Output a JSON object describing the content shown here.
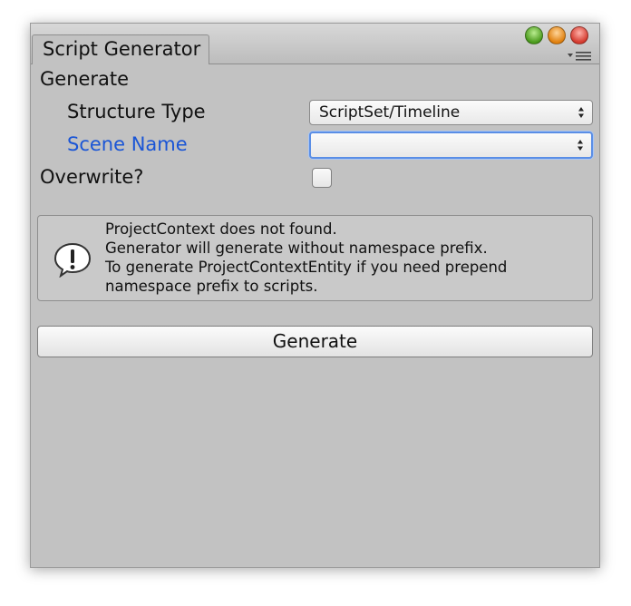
{
  "window": {
    "tab_title": "Script Generator"
  },
  "section": {
    "title": "Generate"
  },
  "fields": {
    "structure_type": {
      "label": "Structure Type",
      "value": "ScriptSet/Timeline"
    },
    "scene_name": {
      "label": "Scene Name",
      "value": ""
    },
    "overwrite": {
      "label": "Overwrite?",
      "checked": false
    }
  },
  "help": {
    "icon": "info-exclamation-icon",
    "lines": [
      "ProjectContext does not found.",
      "Generator will generate without namespace prefix.",
      "To generate ProjectContextEntity if you need prepend",
      "namespace prefix to scripts."
    ]
  },
  "actions": {
    "generate_label": "Generate"
  },
  "colors": {
    "focused_label": "#1a55d6",
    "panel_bg": "#c2c2c2",
    "focus_ring": "#5a8ee6"
  }
}
